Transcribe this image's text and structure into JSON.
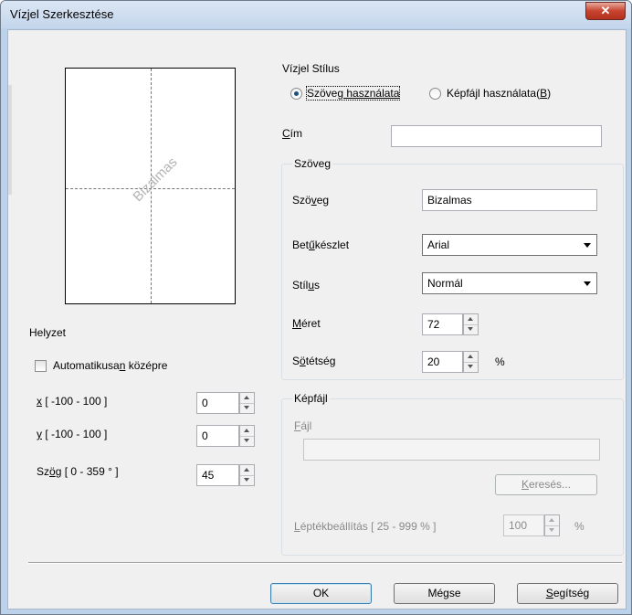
{
  "window": {
    "title": "Vízjel Szerkesztése",
    "close_glyph": "✕"
  },
  "preview": {
    "watermark_text": "Bizalmas"
  },
  "position": {
    "heading": "Helyzet",
    "auto_center_label_pre": "Automatikusa",
    "auto_center_label_u": "n",
    "auto_center_label_post": " középre",
    "auto_center_checked": false,
    "x_label_u": "x",
    "x_label_rest": " [ -100  -  100 ]",
    "x_value": "0",
    "y_label_u": "y",
    "y_label_rest": " [ -100  -  100 ]",
    "y_value": "0",
    "angle_label_pre": "Sz",
    "angle_label_u": "ö",
    "angle_label_post": "g [ 0 - 359 ° ]",
    "angle_value": "45"
  },
  "style": {
    "heading": "Vízjel Stílus",
    "option_text_pre": "Szöve",
    "option_text_u": "g használata",
    "option_image_pre": "Képfájl használata(",
    "option_image_u": "B",
    "option_image_post": ")",
    "selected": "text"
  },
  "title_field": {
    "label_u": "C",
    "label_rest": "ím",
    "value": ""
  },
  "text_group": {
    "legend": "Szöveg",
    "text_label_pre": "Szö",
    "text_label_u": "v",
    "text_label_post": "eg",
    "text_value": "Bizalmas",
    "font_label_pre": "Bet",
    "font_label_u": "ű",
    "font_label_post": "készlet",
    "font_value": "Arial",
    "style_label_pre": "Stíl",
    "style_label_u": "u",
    "style_label_post": "s",
    "style_value": "Normál",
    "size_label_u": "M",
    "size_label_rest": "éret",
    "size_value": "72",
    "darkness_label_pre": "S",
    "darkness_label_u": "ö",
    "darkness_label_post": "tétség",
    "darkness_value": "20",
    "darkness_unit": "%"
  },
  "image_group": {
    "legend": "Képfájl",
    "file_label_u": "F",
    "file_label_rest": "ájl",
    "file_value": "",
    "browse_label_u": "K",
    "browse_label_rest": "eresés...",
    "scale_label_u": "L",
    "scale_label_rest": "éptékbeállítás [ 25 - 999 % ]",
    "scale_value": "100",
    "scale_unit": "%"
  },
  "buttons": {
    "ok": "OK",
    "cancel": "Mégse",
    "help_u": "S",
    "help_rest": "egítség"
  },
  "colors": {
    "titlebar": "#c4d6ec",
    "dialog_bg": "#f0f0f0",
    "close_button": "#c7432f"
  }
}
